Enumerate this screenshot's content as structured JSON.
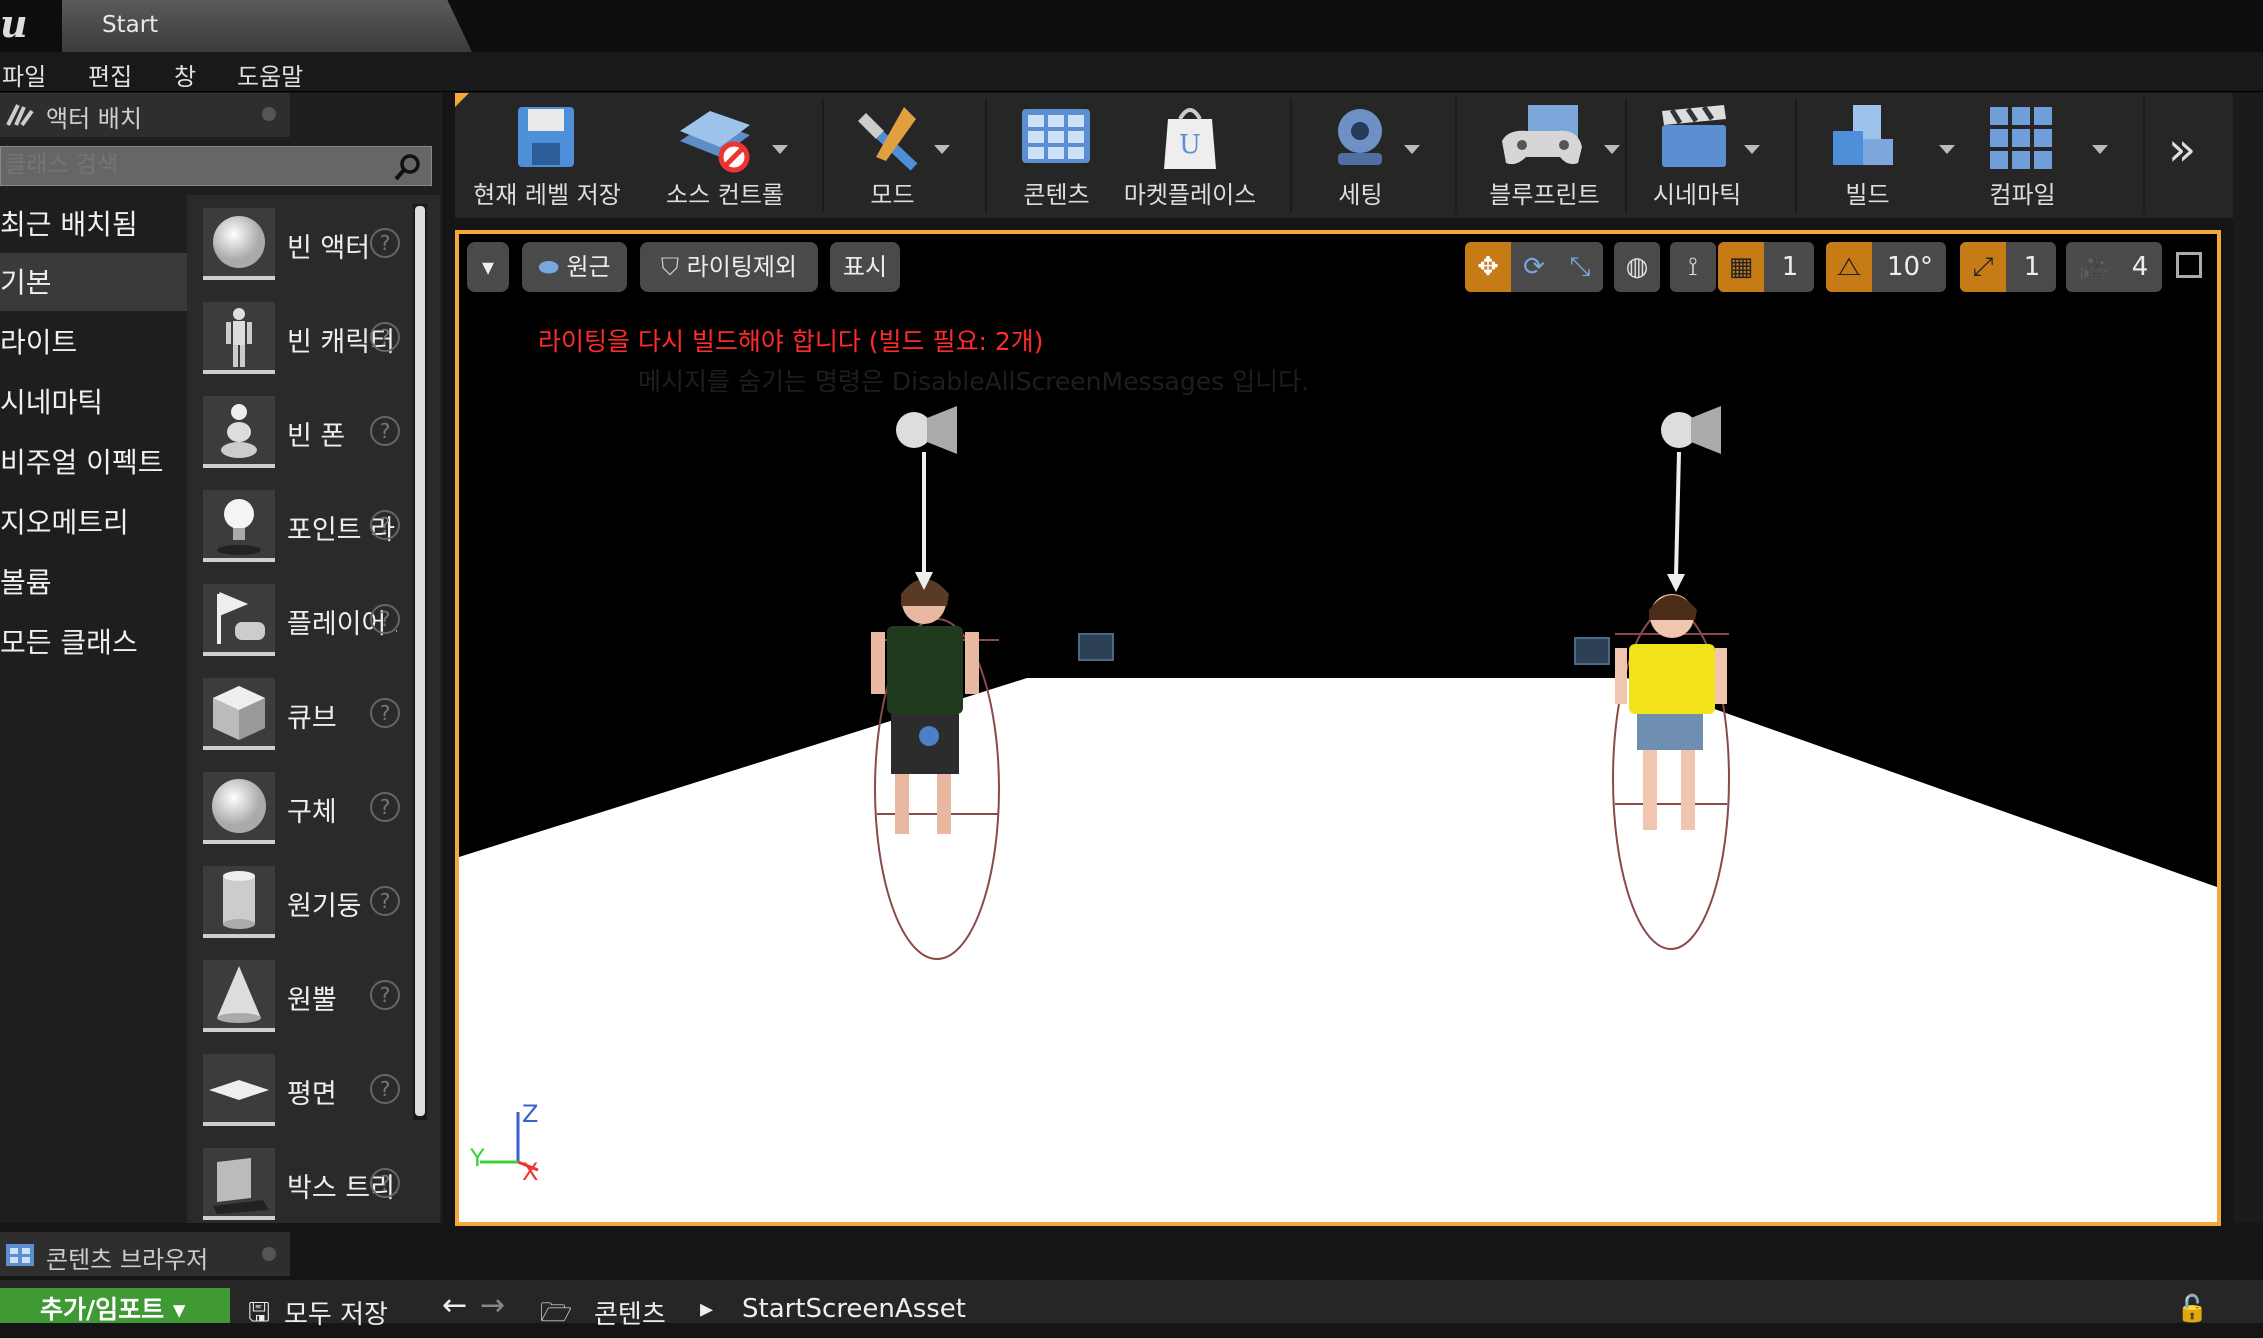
{
  "window": {
    "tab_title": "Start",
    "logo": "u"
  },
  "menu": [
    "파일",
    "편집",
    "창",
    "도움말"
  ],
  "placement_panel": {
    "title": "액터 배치",
    "search_placeholder": "클래스 검색",
    "categories": [
      "최근 배치됨",
      "기본",
      "라이트",
      "시네마틱",
      "비주얼 이펙트",
      "지오메트리",
      "볼륨",
      "모든 클래스"
    ],
    "selected_category": "기본",
    "items": [
      {
        "label": "빈 액터",
        "icon": "empty-actor-icon"
      },
      {
        "label": "빈 캐릭터",
        "icon": "empty-character-icon"
      },
      {
        "label": "빈 폰",
        "icon": "empty-pawn-icon"
      },
      {
        "label": "포인트 라이트",
        "icon": "point-light-icon"
      },
      {
        "label": "플레이어 스타트",
        "icon": "player-start-icon"
      },
      {
        "label": "큐브",
        "icon": "cube-icon"
      },
      {
        "label": "구체",
        "icon": "sphere-icon"
      },
      {
        "label": "원기둥",
        "icon": "cylinder-icon"
      },
      {
        "label": "원뿔",
        "icon": "cone-icon"
      },
      {
        "label": "평면",
        "icon": "plane-icon"
      },
      {
        "label": "박스 트리거",
        "icon": "box-trigger-icon"
      }
    ]
  },
  "toolbar": {
    "buttons": [
      {
        "label": "현재 레벨 저장",
        "icon": "save-level-icon",
        "dropdown": false
      },
      {
        "label": "소스 컨트롤",
        "icon": "source-control-icon",
        "dropdown": true
      },
      {
        "label": "모드",
        "icon": "modes-icon",
        "dropdown": true
      },
      {
        "label": "콘텐츠",
        "icon": "content-icon",
        "dropdown": false
      },
      {
        "label": "마켓플레이스",
        "icon": "marketplace-icon",
        "dropdown": false
      },
      {
        "label": "세팅",
        "icon": "settings-icon",
        "dropdown": true
      },
      {
        "label": "블루프린트",
        "icon": "blueprint-icon",
        "dropdown": true
      },
      {
        "label": "시네마틱",
        "icon": "cinematics-icon",
        "dropdown": true
      },
      {
        "label": "빌드",
        "icon": "build-icon",
        "dropdown": true
      },
      {
        "label": "컴파일",
        "icon": "compile-icon",
        "dropdown": true
      }
    ],
    "more": "»"
  },
  "viewport": {
    "buttons": {
      "perspective": "원근",
      "lighting": "라이팅제외",
      "show": "표시"
    },
    "grid_snap": "1",
    "rotation_snap": "10°",
    "scale_snap": "1",
    "camera_speed": "4",
    "messages": {
      "warning": "라이팅을 다시 빌드해야 합니다 (빌드 필요: 2개)",
      "hint": "메시지를 숨기는 명령은 DisableAllScreenMessages 입니다."
    },
    "axis": {
      "z": "Z",
      "y": "Y",
      "x": "X"
    },
    "colors": {
      "warning": "#ff2b2b",
      "frame": "#f2a93b",
      "active_tool": "#c77b17"
    }
  },
  "content_browser": {
    "title": "콘텐츠 브라우저",
    "add_import": "추가/임포트",
    "save_all": "모두 저장",
    "path": [
      "콘텐츠",
      "StartScreenAsset"
    ]
  }
}
